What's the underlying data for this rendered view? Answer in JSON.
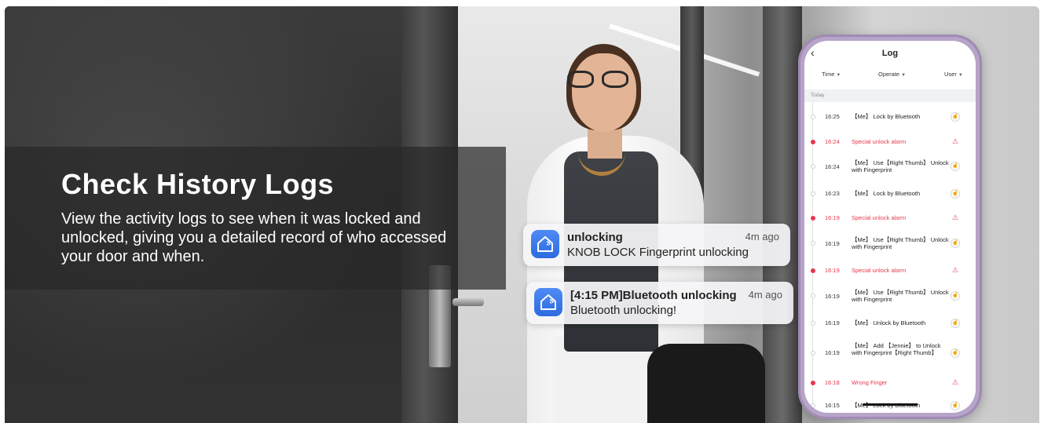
{
  "banner": {
    "headline": "Check History Logs",
    "subtext": "View the activity logs to see when it was locked and unlocked, giving you a detailed record of who accessed your door and when."
  },
  "notifications": [
    {
      "title": "unlocking",
      "body": "KNOB LOCK Fingerprint unlocking",
      "time": "4m ago",
      "icon": "smart-home-app-icon"
    },
    {
      "title": "[4:15 PM]Bluetooth unlocking",
      "body": "Bluetooth unlocking!",
      "time": "4m ago",
      "icon": "smart-home-app-icon"
    }
  ],
  "phone": {
    "back_icon": "‹",
    "title": "Log",
    "filters": [
      "Time",
      "Operate",
      "User"
    ],
    "section": "Today",
    "logs": [
      {
        "time": "16:25",
        "text": "【Me】 Lock by Bluetooth",
        "alarm": false
      },
      {
        "time": "16:24",
        "text": "Special unlock alarm",
        "alarm": true
      },
      {
        "time": "16:24",
        "text": "【Me】 Use【Right Thumb】 Unlock with Fingerprint",
        "alarm": false
      },
      {
        "time": "16:23",
        "text": "【Me】 Lock by Bluetooth",
        "alarm": false
      },
      {
        "time": "16:19",
        "text": "Special unlock alarm",
        "alarm": true
      },
      {
        "time": "16:19",
        "text": "【Me】 Use【Right Thumb】 Unlock with Fingerprint",
        "alarm": false
      },
      {
        "time": "16:19",
        "text": "Special unlock alarm",
        "alarm": true
      },
      {
        "time": "16:19",
        "text": "【Me】 Use【Right Thumb】 Unlock with Fingerprint",
        "alarm": false
      },
      {
        "time": "16:19",
        "text": "【Me】 Unlock by Bluetooth",
        "alarm": false
      },
      {
        "time": "16:19",
        "text": "【Me】 Add 【Jennie】 to Unlock with Fingerprint【Right Thumb】",
        "alarm": false
      },
      {
        "time": "16:18",
        "text": "Wrong Finger",
        "alarm": true
      },
      {
        "time": "16:15",
        "text": "【Me】 Lock by Bluetooth",
        "alarm": false
      }
    ]
  },
  "colors": {
    "alarm": "#e8374c",
    "app_icon": "#2d6be0",
    "phone_frame": "#b7a4c9"
  }
}
